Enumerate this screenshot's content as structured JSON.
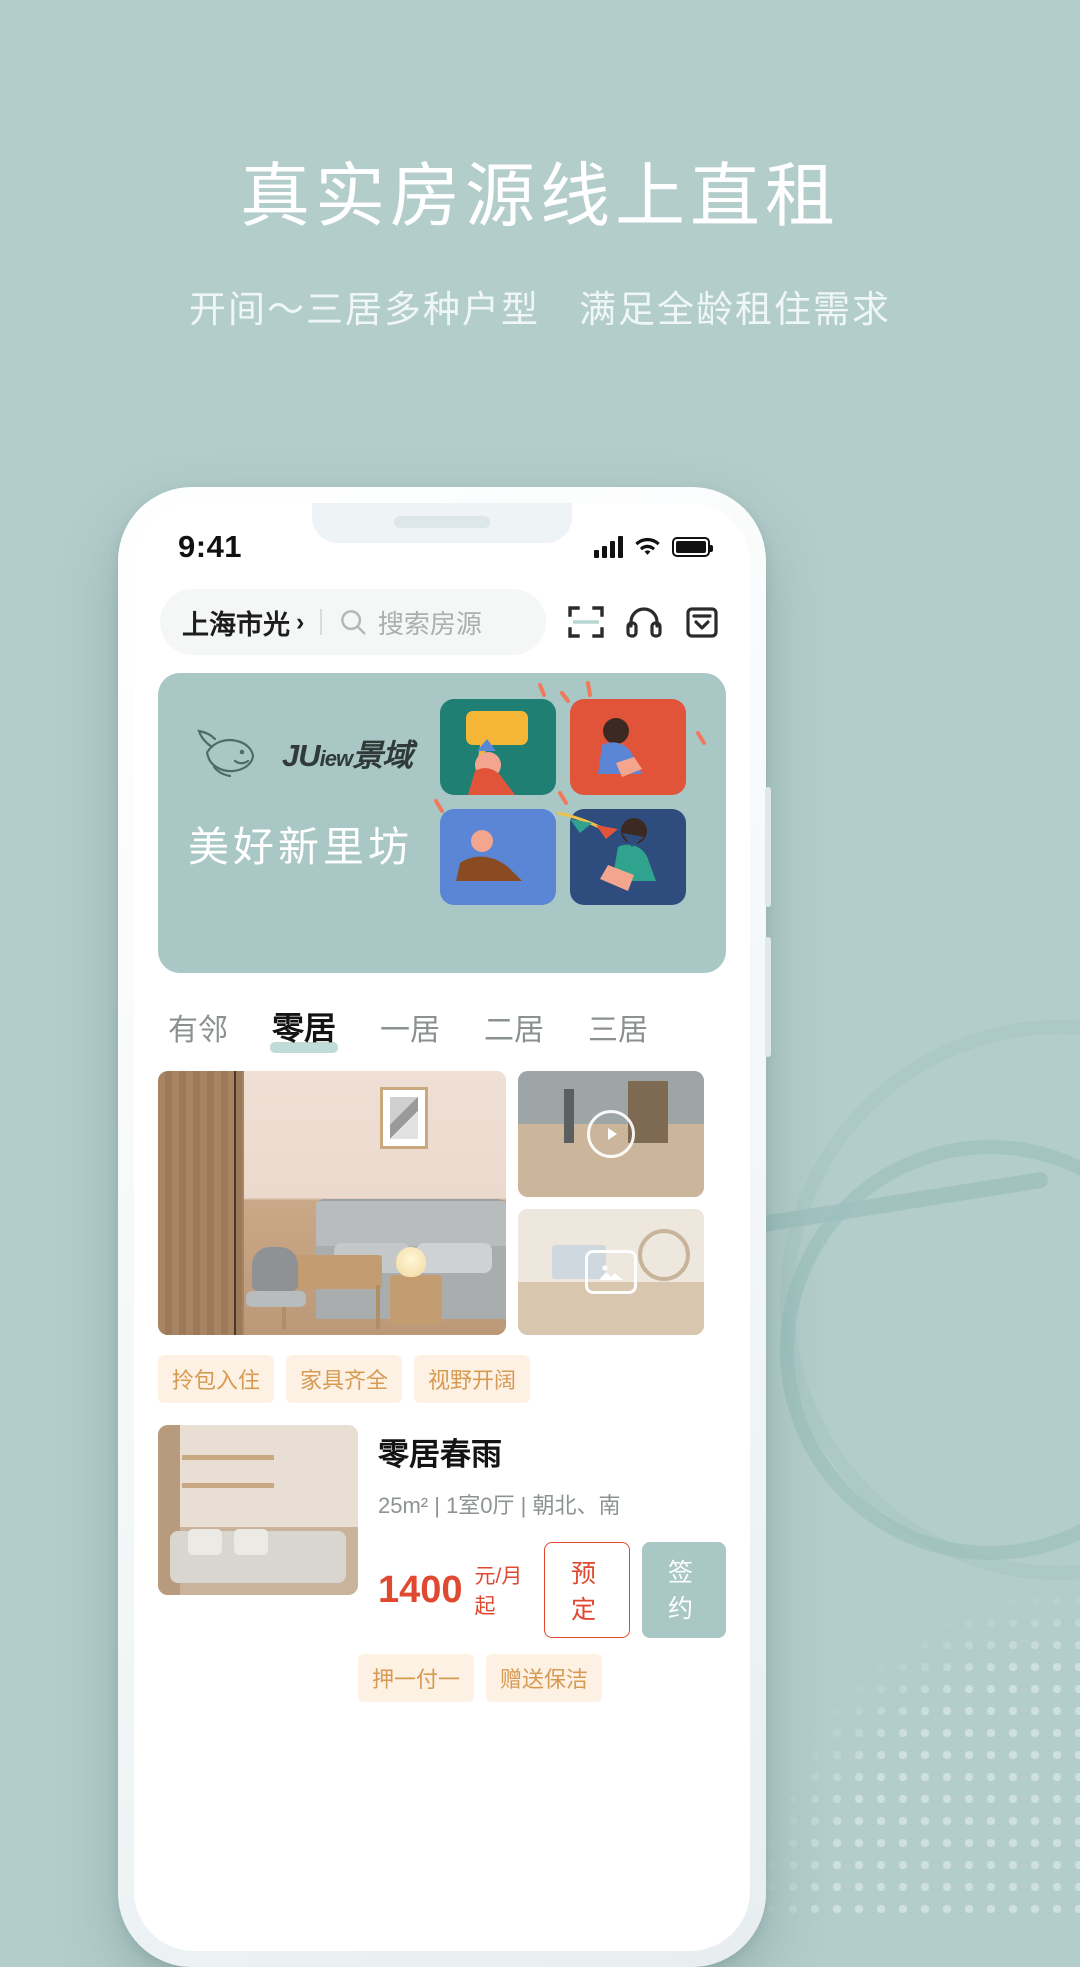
{
  "promo": {
    "headline": "真实房源线上直租",
    "subhead": "开间～三居多种户型　满足全龄租住需求",
    "bg_color": "#b3cdcb"
  },
  "status_bar": {
    "time": "9:41",
    "signal_icon": "signal-bars-icon",
    "wifi_icon": "wifi-icon",
    "battery_icon": "battery-icon"
  },
  "search": {
    "location": "上海市光",
    "chevron": "›",
    "search_icon": "search-icon",
    "placeholder": "搜索房源",
    "value": ""
  },
  "top_icons": [
    {
      "name": "scan-icon",
      "label": "扫一扫"
    },
    {
      "name": "headset-icon",
      "label": "客服"
    },
    {
      "name": "inbox-icon",
      "label": "消息"
    }
  ],
  "banner": {
    "brand_mark": "whale-icon",
    "brand_text_a": "JU",
    "brand_text_b": "iew",
    "brand_text_c": "景域",
    "slogan": "美好新里坊",
    "bg_color": "#a8c7c5"
  },
  "tabs": [
    {
      "label": "有邻",
      "active": false
    },
    {
      "label": "零居",
      "active": true
    },
    {
      "label": "一居",
      "active": false
    },
    {
      "label": "二居",
      "active": false
    },
    {
      "label": "三居",
      "active": false
    }
  ],
  "gallery": {
    "main_alt": "卧室主图",
    "sub_1_alt": "客厅视频",
    "sub_1_badge": "play-icon",
    "sub_2_alt": "书桌相册",
    "sub_2_badge": "photo-icon"
  },
  "feature_chips": [
    "拎包入住",
    "家具齐全",
    "视野开阔"
  ],
  "listing": {
    "thumb_alt": "零居春雨房型图",
    "title": "零居春雨",
    "meta": "25m² | 1室0厅 | 朝北、南",
    "price": "1400",
    "price_unit": "元/月起",
    "price_color": "#e0492f",
    "btn_reserve": "预定",
    "btn_sign": "签约",
    "tags": [
      "押一付一",
      "赠送保洁"
    ]
  }
}
